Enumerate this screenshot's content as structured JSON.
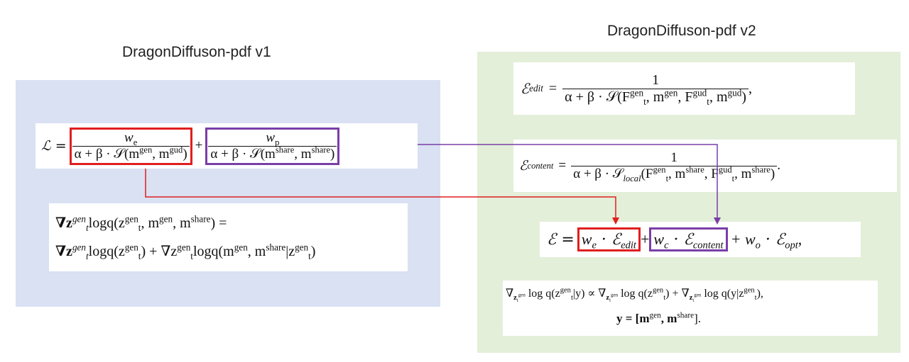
{
  "titles": {
    "v1": "DragonDiffuson-pdf v1",
    "v2": "DragonDiffuson-pdf v2"
  },
  "colors": {
    "v1_panel": "#d9e1f3",
    "v2_panel": "#e3efd9",
    "red_highlight": "#e01f1f",
    "purple_highlight": "#7a3ea8"
  },
  "v1": {
    "loss_lhs": "ℒ =",
    "we_num": "w",
    "we_num_sub": "e",
    "we_den": "α + β · 𝒮(m",
    "we_den_sup1": "gen",
    "we_den_mid": ", m",
    "we_den_sup2": "gud",
    "we_den_end": ")",
    "plus": "+",
    "wp_num": "w",
    "wp_num_sub": "p",
    "wp_den": "α + β · 𝒮(m",
    "wp_den_sup1": "share",
    "wp_den_mid": ", m",
    "wp_den_sup2": "share",
    "wp_den_end": ")",
    "grad_line1": "∇z",
    "grad_line1_sup": "gen",
    "grad_line1_sub": "t",
    "grad_line1_rest": "logq(z",
    "grad_line1_rest_sup": "gen",
    "grad_line1_rest_sub": "t",
    "grad_line1_end": ", m",
    "grad_line1_end_sup1": "gen",
    "grad_line1_end_mid": ", m",
    "grad_line1_end_sup2": "share",
    "grad_line1_eq": ") =",
    "grad_line2_a": "∇z",
    "grad_line2_a_sup": "gen",
    "grad_line2_a_sub": "t",
    "grad_line2_b": "logq(z",
    "grad_line2_b_sup": "gen",
    "grad_line2_b_sub": "t",
    "grad_line2_c": ") + ∇z",
    "grad_line2_c_sup": "gen",
    "grad_line2_c_sub": "t",
    "grad_line2_d": "logq(m",
    "grad_line2_d_sup1": "gen",
    "grad_line2_d_mid": ", m",
    "grad_line2_d_sup2": "share",
    "grad_line2_e": "|z",
    "grad_line2_e_sup": "gen",
    "grad_line2_e_sub": "t",
    "grad_line2_end": ")"
  },
  "v2": {
    "edit_lhs": "ℰ",
    "edit_lhs_sub": "edit",
    "edit_eq": "=",
    "edit_num": "1",
    "edit_den": "α + β · 𝒮(F",
    "edit_den_sup1": "gen",
    "edit_den_sub1": "t",
    "edit_den_mid1": ", m",
    "edit_den_sup2": "gen",
    "edit_den_mid2": ", F",
    "edit_den_sup3": "gud",
    "edit_den_sub3": "t",
    "edit_den_mid3": ", m",
    "edit_den_sup4": "gud",
    "edit_den_end": ")",
    "edit_tail": ",",
    "content_lhs": "ℰ",
    "content_lhs_sub": "content",
    "content_eq": "=",
    "content_num": "1",
    "content_den": "α + β · 𝒮",
    "content_den_sub0": "local",
    "content_den_a": "(F",
    "content_den_sup1": "gen",
    "content_den_sub1": "t",
    "content_den_mid1": ", m",
    "content_den_sup2": "share",
    "content_den_mid2": ", F",
    "content_den_sup3": "gud",
    "content_den_sub3": "t",
    "content_den_mid3": ", m",
    "content_den_sup4": "share",
    "content_den_end": ")",
    "content_tail": ".",
    "total_lhs": "ℰ =",
    "total_t1": "w",
    "total_t1_sub": "e",
    "total_t1_rest": " · ℰ",
    "total_t1_rest_sub": "edit",
    "total_plus1": "+",
    "total_t2": "w",
    "total_t2_sub": "c",
    "total_t2_rest": " · ℰ",
    "total_t2_rest_sub": "content",
    "total_t3": "+ w",
    "total_t3_sub": "o",
    "total_t3_rest": " · ℰ",
    "total_t3_rest_sub": "opt",
    "total_tail": ",",
    "grad_a": "∇",
    "grad_a_sub": "z",
    "grad_a_subsub": "t",
    "grad_a_subsup": "gen",
    "grad_b": " log q(z",
    "grad_b_sup": "gen",
    "grad_b_sub": "t",
    "grad_c": "|y) ∝ ∇",
    "grad_c_sub": "z",
    "grad_c_subsub": "t",
    "grad_c_subsup": "gen",
    "grad_d": " log q(z",
    "grad_d_sup": "gen",
    "grad_d_sub": "t",
    "grad_e": ") + ∇",
    "grad_e_sub": "z",
    "grad_e_subsub": "t",
    "grad_e_subsup": "gen",
    "grad_f": " log q(y|z",
    "grad_f_sup": "gen",
    "grad_f_sub": "t",
    "grad_end": "),",
    "y_line": "y = [m",
    "y_sup1": "gen",
    "y_mid": ", m",
    "y_sup2": "share",
    "y_end": "]."
  }
}
